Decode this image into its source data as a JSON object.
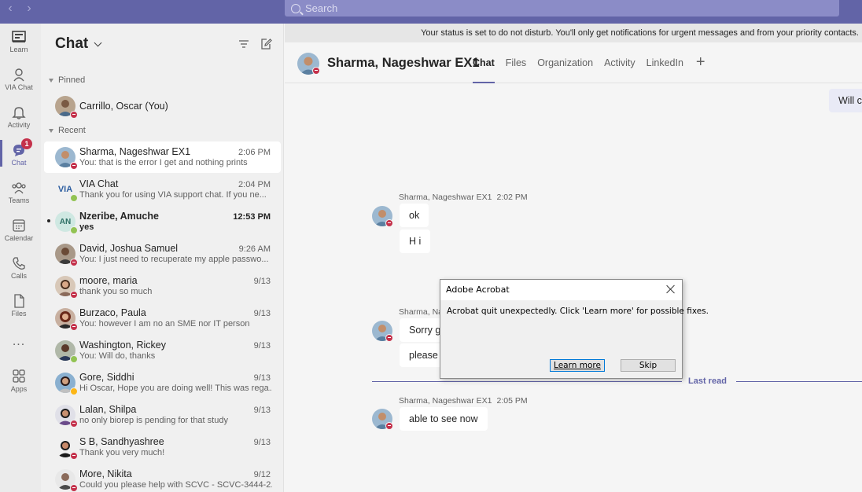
{
  "topbar": {
    "back_icon": "chevron-left-icon",
    "forward_icon": "chevron-right-icon",
    "search_placeholder": "Search"
  },
  "rail": {
    "items": [
      {
        "label": "Learn",
        "icon": "book-icon"
      },
      {
        "label": "VIA Chat",
        "icon": "bot-icon"
      },
      {
        "label": "Activity",
        "icon": "bell-icon"
      },
      {
        "label": "Chat",
        "icon": "chat-icon",
        "badge": "1"
      },
      {
        "label": "Teams",
        "icon": "teams-icon"
      },
      {
        "label": "Calendar",
        "icon": "calendar-icon"
      },
      {
        "label": "Calls",
        "icon": "phone-icon"
      },
      {
        "label": "Files",
        "icon": "file-icon"
      },
      {
        "label": "...",
        "icon": "more-icon"
      },
      {
        "label": "Apps",
        "icon": "apps-icon"
      }
    ]
  },
  "chatlist": {
    "title": "Chat",
    "pinned_label": "Pinned",
    "recent_label": "Recent",
    "pinned": [
      {
        "name": "Carrillo, Oscar (You)",
        "presence": "dnd"
      }
    ],
    "recent": [
      {
        "name": "Sharma, Nageshwar EX1",
        "preview": "You: that is the error I get and nothing prints",
        "time": "2:06 PM",
        "presence": "dnd",
        "selected": true
      },
      {
        "name": "VIA Chat",
        "preview": "Thank you for using VIA support chat. If you ne...",
        "time": "2:04 PM",
        "presence": "available",
        "initials": "VIA"
      },
      {
        "name": "Nzeribe, Amuche",
        "preview": "yes",
        "time": "12:53 PM",
        "presence": "available",
        "initials": "AN",
        "unread": true
      },
      {
        "name": "David, Joshua Samuel",
        "preview": "You: I just need to recuperate my apple passwo...",
        "time": "9:26 AM",
        "presence": "dnd"
      },
      {
        "name": "moore, maria",
        "preview": "thank you so much",
        "time": "9/13",
        "presence": "dnd"
      },
      {
        "name": "Burzaco, Paula",
        "preview": "You: however I am no an SME nor IT person",
        "time": "9/13",
        "presence": "dnd"
      },
      {
        "name": "Washington, Rickey",
        "preview": "You: Will do, thanks",
        "time": "9/13",
        "presence": "available"
      },
      {
        "name": "Gore, Siddhi",
        "preview": "Hi Oscar, Hope you are doing well! This was rega...",
        "time": "9/13",
        "presence": "away"
      },
      {
        "name": "Lalan, Shilpa",
        "preview": "no only biorep is pending for that study",
        "time": "9/13",
        "presence": "dnd"
      },
      {
        "name": "S B, Sandhyashree",
        "preview": "Thank you very much!",
        "time": "9/13",
        "presence": "dnd"
      },
      {
        "name": "More, Nikita",
        "preview": "Could you please help with SCVC - SCVC-3444-2...",
        "time": "9/12",
        "presence": "dnd"
      }
    ]
  },
  "main": {
    "status_notice": "Your status is set to do not disturb. You'll only get notifications for urgent messages and from your priority contacts.",
    "conversation_title": "Sharma, Nageshwar EX1",
    "tabs": [
      "Chat",
      "Files",
      "Organization",
      "Activity",
      "LinkedIn"
    ],
    "add_tab_icon": "plus-icon",
    "my_partial_message": "Will c",
    "groups": [
      {
        "sender": "Sharma, Nageshwar EX1",
        "time": "2:02 PM",
        "messages": [
          "ok",
          "H i"
        ]
      },
      {
        "sender": "Sharma, Nageshwar EX1",
        "time": "",
        "messages": [
          "Sorry g",
          "please s"
        ]
      },
      {
        "sender": "Sharma, Nageshwar EX1",
        "time": "2:05 PM",
        "messages": [
          "able to see now"
        ]
      }
    ],
    "last_read_label": "Last read"
  },
  "dialog": {
    "title": "Adobe Acrobat",
    "message": "Acrobat quit unexpectedly. Click 'Learn more' for possible fixes.",
    "learn_more_label": "Learn more",
    "skip_label": "Skip"
  },
  "colors": {
    "brand": "#6264a7",
    "dnd": "#c4314b",
    "available": "#92c353",
    "away": "#fcb616"
  }
}
